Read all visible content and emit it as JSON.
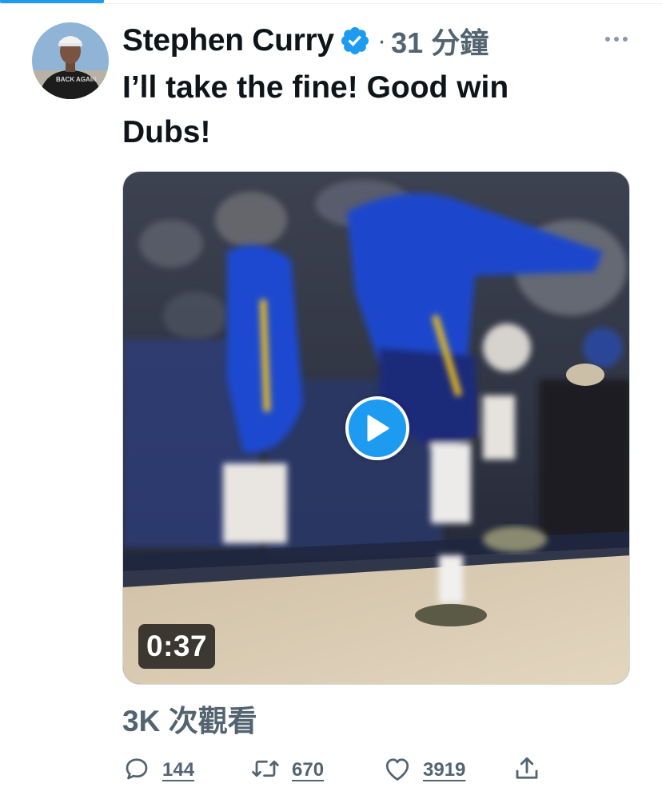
{
  "tweet": {
    "author_name": "Stephen Curry",
    "verified": true,
    "separator": "·",
    "timestamp": "31 分鐘",
    "text": "I’ll take the fine! Good win\nDubs!",
    "avatar_text": "BACK AGAIN",
    "media": {
      "type": "video",
      "duration": "0:37"
    },
    "views": "3K 次觀看",
    "actions": {
      "reply_count": "144",
      "retweet_count": "670",
      "like_count": "3919"
    }
  },
  "colors": {
    "accent": "#1d9bf0",
    "secondary_text": "#536471",
    "primary_text": "#0f1419"
  },
  "icons": [
    "verified-badge-icon",
    "more-icon",
    "play-icon",
    "reply-icon",
    "retweet-icon",
    "like-icon",
    "share-icon"
  ]
}
